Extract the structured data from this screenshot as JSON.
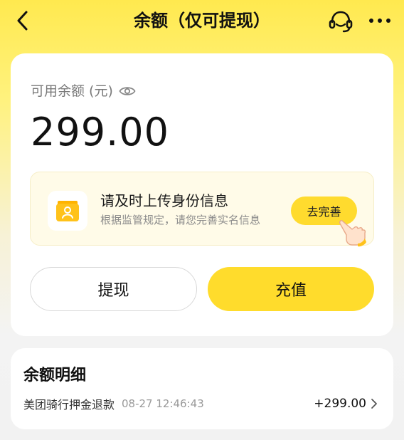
{
  "header": {
    "title": "余额（仅可提现）",
    "icons": {
      "back": "chevron-left-icon",
      "support": "headset-icon",
      "more": "more-icon"
    }
  },
  "balance": {
    "label": "可用余额 (元)",
    "amount": "299.00",
    "visibility_icon": "eye-icon"
  },
  "notice": {
    "title": "请及时上传身份信息",
    "subtitle": "根据监管规定，请您完善实名信息",
    "button_label": "去完善",
    "icon": "id-card-icon"
  },
  "actions": {
    "withdraw_label": "提现",
    "recharge_label": "充值"
  },
  "details": {
    "title": "余额明细",
    "transactions": [
      {
        "name": "美团骑行押金退款",
        "time": "08-27 12:46:43",
        "amount": "+299.00"
      }
    ]
  },
  "colors": {
    "accent": "#ffdc2c",
    "header_bg": "#ffe94f",
    "notice_bg": "#fffbe8"
  }
}
